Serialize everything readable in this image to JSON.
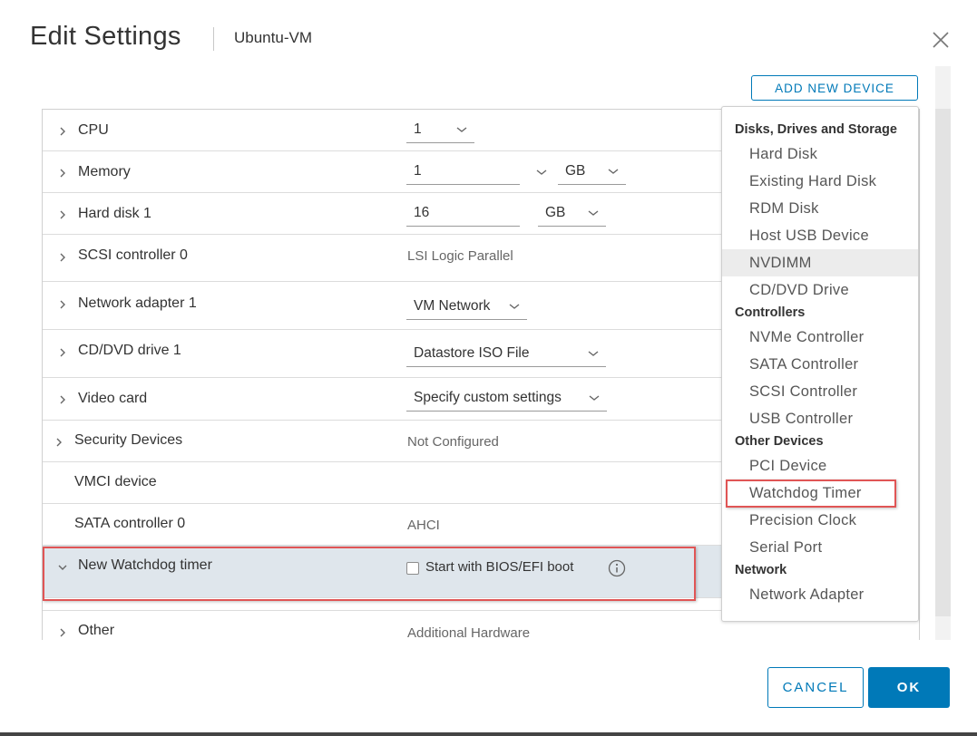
{
  "dialog": {
    "title": "Edit Settings",
    "vm_name": "Ubuntu-VM",
    "close_icon": "close-icon",
    "add_device_label": "ADD NEW DEVICE"
  },
  "rows": [
    {
      "label": "CPU",
      "value": "1",
      "control": "select"
    },
    {
      "label": "Memory",
      "value": "1",
      "unit": "GB",
      "control": "input-select-unit"
    },
    {
      "label": "Hard disk 1",
      "value": "16",
      "unit": "GB",
      "control": "input-unit"
    },
    {
      "label": "SCSI controller 0",
      "value": "LSI Logic Parallel",
      "control": "text"
    },
    {
      "label": "Network adapter 1",
      "value": "VM Network",
      "control": "select"
    },
    {
      "label": "CD/DVD drive 1",
      "value": "Datastore ISO File",
      "control": "select"
    },
    {
      "label": "Video card",
      "value": "Specify custom settings",
      "control": "select"
    },
    {
      "label": "Security Devices",
      "value": "Not Configured",
      "control": "text"
    },
    {
      "label": "VMCI device",
      "value": "",
      "control": "none"
    },
    {
      "label": "SATA controller 0",
      "value": "AHCI",
      "control": "text"
    },
    {
      "label": "New Watchdog timer",
      "checkbox_label": "Start with BIOS/EFI boot",
      "checked": false,
      "expanded": true,
      "control": "checkbox"
    },
    {
      "label": "Other",
      "value": "Additional Hardware",
      "control": "text"
    }
  ],
  "dropdown": {
    "groups": [
      {
        "heading": "Disks, Drives and Storage",
        "items": [
          "Hard Disk",
          "Existing Hard Disk",
          "RDM Disk",
          "Host USB Device",
          "NVDIMM",
          "CD/DVD Drive"
        ]
      },
      {
        "heading": "Controllers",
        "items": [
          "NVMe Controller",
          "SATA Controller",
          "SCSI Controller",
          "USB Controller"
        ]
      },
      {
        "heading": "Other Devices",
        "items": [
          "PCI Device",
          "Watchdog Timer",
          "Precision Clock",
          "Serial Port"
        ]
      },
      {
        "heading": "Network",
        "items": [
          "Network Adapter"
        ]
      }
    ],
    "hovered_item": "NVDIMM",
    "highlighted_item": "Watchdog Timer"
  },
  "footer": {
    "cancel_label": "CANCEL",
    "ok_label": "OK"
  },
  "colors": {
    "accent": "#0079b8",
    "highlight_box": "#e05555",
    "selected_row": "#dfe6ec"
  }
}
